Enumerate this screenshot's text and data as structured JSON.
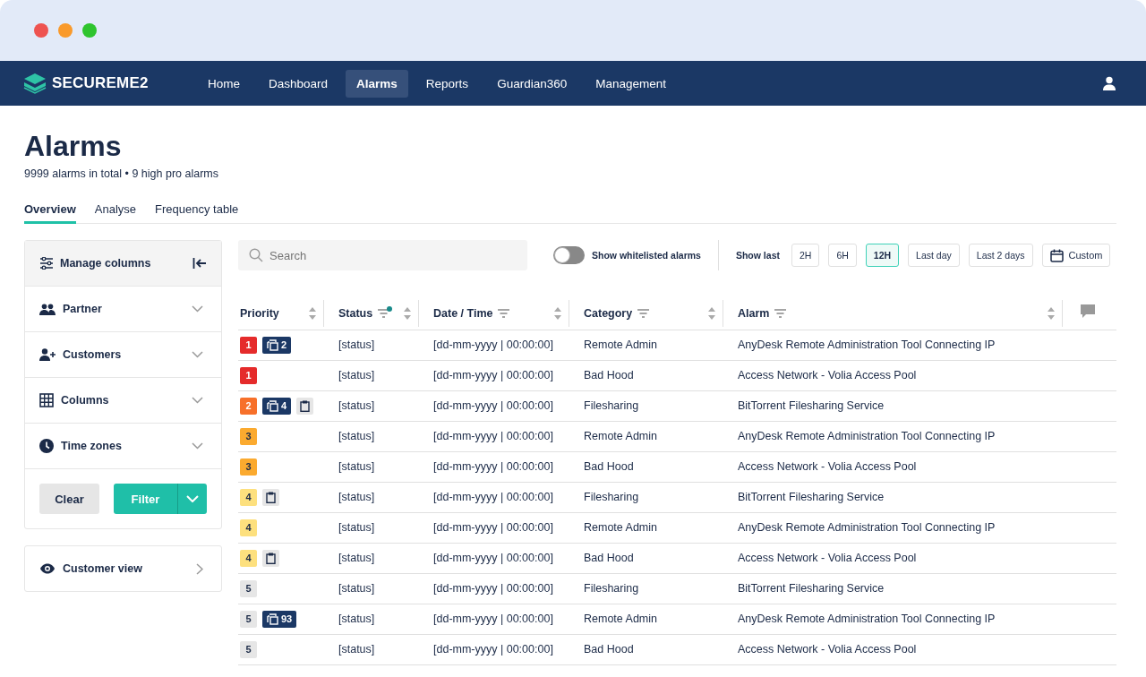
{
  "brand": {
    "name": "SECUREME2"
  },
  "nav": [
    {
      "label": "Home",
      "selected": false
    },
    {
      "label": "Dashboard",
      "selected": false
    },
    {
      "label": "Alarms",
      "selected": true
    },
    {
      "label": "Reports",
      "selected": false
    },
    {
      "label": "Guardian360",
      "selected": false
    },
    {
      "label": "Management",
      "selected": false
    }
  ],
  "page": {
    "title": "Alarms",
    "subtitle": "9999 alarms in total • 9 high pro alarms"
  },
  "tabs": [
    {
      "label": "Overview",
      "selected": true
    },
    {
      "label": "Analyse",
      "selected": false
    },
    {
      "label": "Frequency table",
      "selected": false
    }
  ],
  "sidebar": {
    "header": "Manage columns",
    "items": [
      {
        "label": "Partner",
        "expanded": false
      },
      {
        "label": "Customers",
        "expanded": false
      },
      {
        "label": "Columns",
        "expanded": false
      },
      {
        "label": "Time zones",
        "expanded": false
      }
    ],
    "clear": "Clear",
    "filter": "Filter",
    "customer_view": "Customer view"
  },
  "search": {
    "placeholder": "Search"
  },
  "whitelist_toggle": {
    "label": "Show whitelisted alarms",
    "on": false
  },
  "show_last": {
    "label": "Show last",
    "options": [
      {
        "label": "2H",
        "selected": false
      },
      {
        "label": "6H",
        "selected": false
      },
      {
        "label": "12H",
        "selected": true
      },
      {
        "label": "Last day",
        "selected": false
      },
      {
        "label": "Last 2 days",
        "selected": false
      }
    ],
    "custom": "Custom"
  },
  "table": {
    "columns": [
      {
        "label": "Priority",
        "filterable": false,
        "filter_active": false
      },
      {
        "label": "Status",
        "filterable": true,
        "filter_active": true
      },
      {
        "label": "Date / Time",
        "filterable": true,
        "filter_active": false
      },
      {
        "label": "Category",
        "filterable": true,
        "filter_active": false
      },
      {
        "label": "Alarm",
        "filterable": true,
        "filter_active": false
      }
    ],
    "rows": [
      {
        "priority": "1",
        "color": "#e52b2b",
        "copies": "2",
        "clipboard": false,
        "status": "[status]",
        "datetime": "[dd-mm-yyyy | 00:00:00]",
        "category": "Remote Admin",
        "alarm": "AnyDesk Remote Administration Tool Connecting IP"
      },
      {
        "priority": "1",
        "color": "#e52b2b",
        "clipboard": false,
        "status": "[status]",
        "datetime": "[dd-mm-yyyy | 00:00:00]",
        "category": "Bad Hood",
        "alarm": "Access Network - Volia Access Pool"
      },
      {
        "priority": "2",
        "color": "#f7702a",
        "copies": "4",
        "clipboard": true,
        "status": "[status]",
        "datetime": "[dd-mm-yyyy | 00:00:00]",
        "category": "Filesharing",
        "alarm": "BitTorrent Filesharing Service"
      },
      {
        "priority": "3",
        "color": "#fbaa2f",
        "clipboard": false,
        "status": "[status]",
        "datetime": "[dd-mm-yyyy | 00:00:00]",
        "category": "Remote Admin",
        "alarm": "AnyDesk Remote Administration Tool Connecting IP"
      },
      {
        "priority": "3",
        "color": "#fbaa2f",
        "clipboard": false,
        "status": "[status]",
        "datetime": "[dd-mm-yyyy | 00:00:00]",
        "category": "Bad Hood",
        "alarm": "Access Network - Volia Access Pool"
      },
      {
        "priority": "4",
        "color": "#fde07e",
        "clipboard": true,
        "status": "[status]",
        "datetime": "[dd-mm-yyyy | 00:00:00]",
        "category": "Filesharing",
        "alarm": "BitTorrent Filesharing Service"
      },
      {
        "priority": "4",
        "color": "#fde07e",
        "clipboard": false,
        "status": "[status]",
        "datetime": "[dd-mm-yyyy | 00:00:00]",
        "category": "Remote Admin",
        "alarm": "AnyDesk Remote Administration Tool Connecting IP"
      },
      {
        "priority": "4",
        "color": "#fde07e",
        "clipboard": true,
        "status": "[status]",
        "datetime": "[dd-mm-yyyy | 00:00:00]",
        "category": "Bad Hood",
        "alarm": "Access Network - Volia Access Pool"
      },
      {
        "priority": "5",
        "color": "#e6e6e6",
        "clipboard": false,
        "status": "[status]",
        "datetime": "[dd-mm-yyyy | 00:00:00]",
        "category": "Filesharing",
        "alarm": "BitTorrent Filesharing Service"
      },
      {
        "priority": "5",
        "color": "#e6e6e6",
        "copies": "93",
        "clipboard": false,
        "status": "[status]",
        "datetime": "[dd-mm-yyyy | 00:00:00]",
        "category": "Remote Admin",
        "alarm": "AnyDesk Remote Administration Tool Connecting IP"
      },
      {
        "priority": "5",
        "color": "#e6e6e6",
        "clipboard": false,
        "status": "[status]",
        "datetime": "[dd-mm-yyyy | 00:00:00]",
        "category": "Bad Hood",
        "alarm": "Access Network - Volia Access Pool"
      }
    ]
  }
}
